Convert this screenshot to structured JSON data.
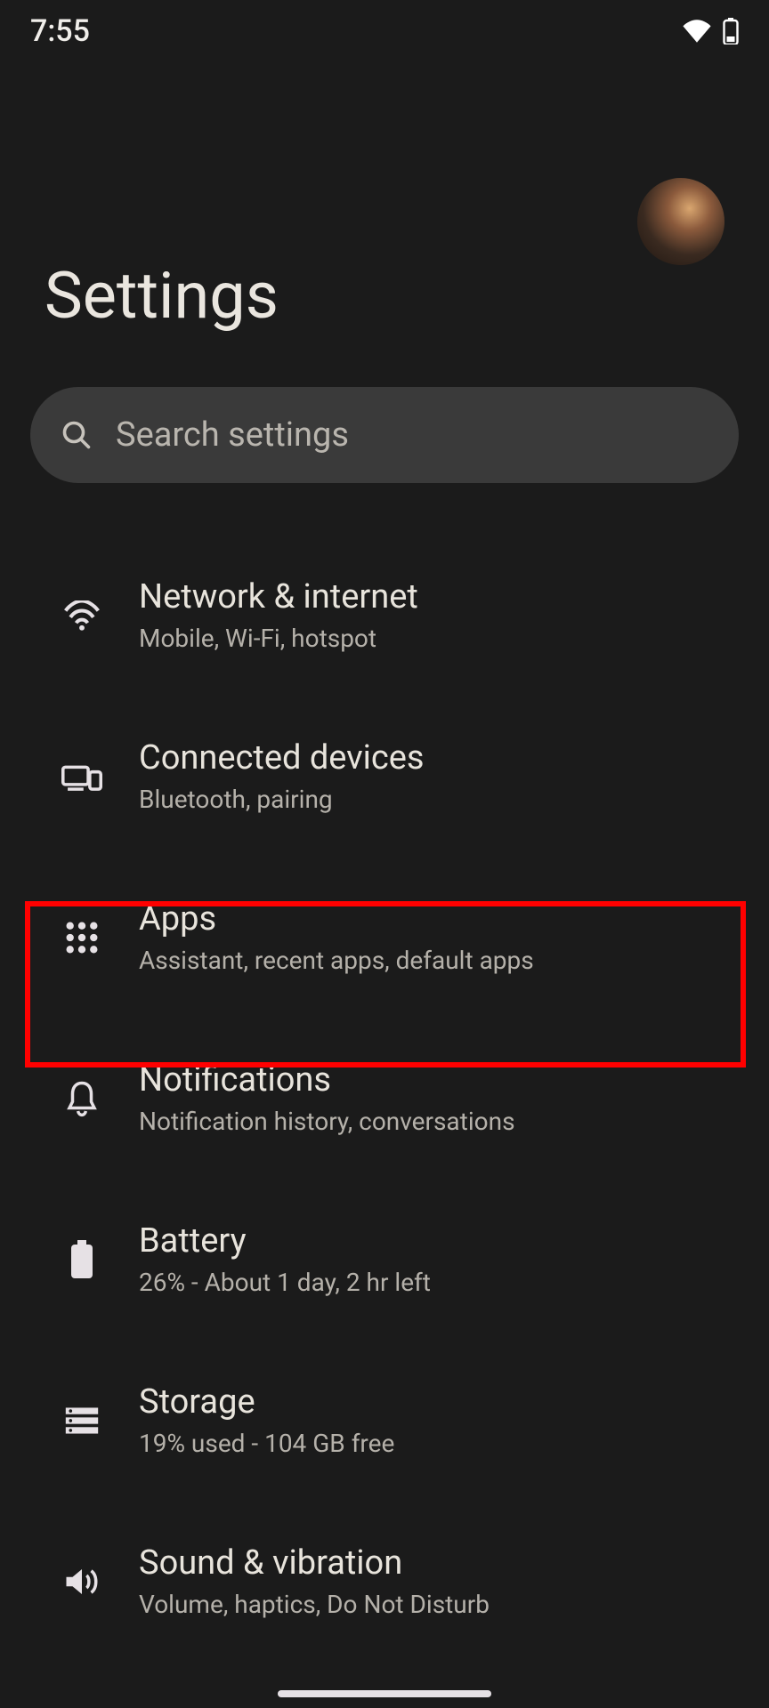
{
  "statusbar": {
    "time": "7:55"
  },
  "header": {
    "title": "Settings"
  },
  "search": {
    "placeholder": "Search settings"
  },
  "items": [
    {
      "title": "Network & internet",
      "subtitle": "Mobile, Wi-Fi, hotspot"
    },
    {
      "title": "Connected devices",
      "subtitle": "Bluetooth, pairing"
    },
    {
      "title": "Apps",
      "subtitle": "Assistant, recent apps, default apps"
    },
    {
      "title": "Notifications",
      "subtitle": "Notification history, conversations"
    },
    {
      "title": "Battery",
      "subtitle": "26% - About 1 day, 2 hr left"
    },
    {
      "title": "Storage",
      "subtitle": "19% used - 104 GB free"
    },
    {
      "title": "Sound & vibration",
      "subtitle": "Volume, haptics, Do Not Disturb"
    }
  ],
  "highlighted_index": 2
}
